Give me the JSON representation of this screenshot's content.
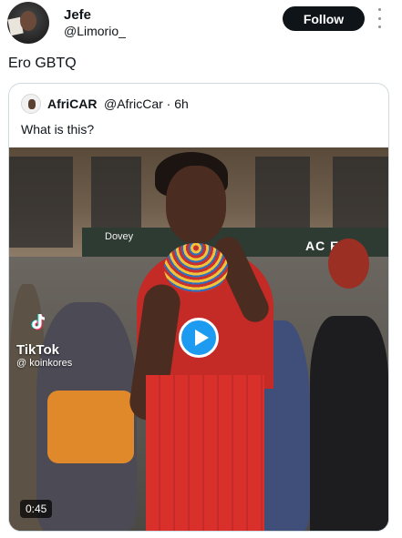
{
  "author": {
    "name": "Jefe",
    "handle": "@Limorio_"
  },
  "header": {
    "follow_label": "Follow",
    "more_icon": "more-vertical-icon"
  },
  "tweet": {
    "text": "Ero GBTQ"
  },
  "quote": {
    "name": "AfriCAR",
    "meta": "@AfricCar · 6h",
    "text": "What is this?"
  },
  "video": {
    "watermark_brand": "TikTok",
    "watermark_user": "@ koinkores",
    "sign_text": "AC  EC",
    "shop_text": "Dovey",
    "duration": "0:45",
    "play_icon": "play-icon"
  },
  "colors": {
    "accent": "#1d9bf0",
    "follow_bg": "#0f1419",
    "border": "#cfd9de"
  }
}
